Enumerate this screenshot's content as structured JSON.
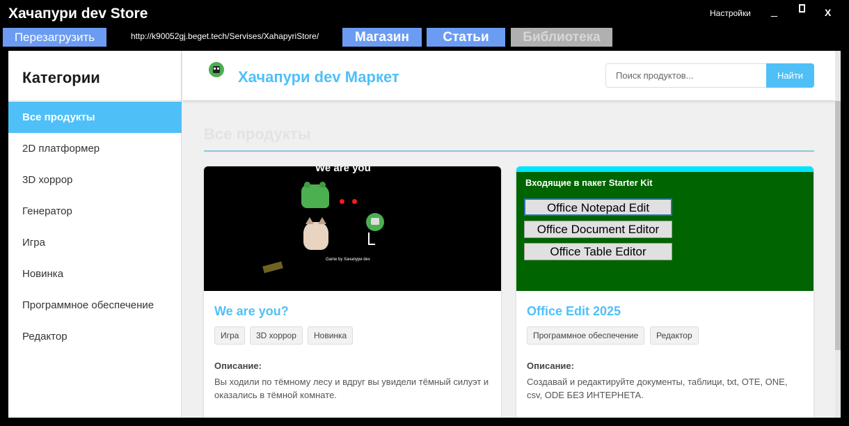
{
  "window": {
    "title": "Хачапури dev Store",
    "settings_label": "Настройки",
    "minimize_label": "_",
    "close_label": "X"
  },
  "toolbar": {
    "reload_label": "Перезагрузить",
    "url": "http://k90052gj.beget.tech/Servises/XahapyriStore/",
    "tabs": [
      {
        "label": "Магазин",
        "active": true
      },
      {
        "label": "Статьи",
        "active": true
      },
      {
        "label": "Библиотека",
        "active": false
      }
    ]
  },
  "sidebar": {
    "title": "Категории",
    "items": [
      {
        "label": "Все продукты",
        "active": true
      },
      {
        "label": "2D платформер"
      },
      {
        "label": "3D хоррор"
      },
      {
        "label": "Генератор"
      },
      {
        "label": "Игра"
      },
      {
        "label": "Новинка"
      },
      {
        "label": "Программное обеспечение"
      },
      {
        "label": "Редактор"
      }
    ]
  },
  "header": {
    "market_title": "Хачапури dev Маркет",
    "search_placeholder": "Поиск продуктов...",
    "search_button": "Найти"
  },
  "main": {
    "section_title": "Все продукты",
    "products": [
      {
        "title": "We are you?",
        "tags": [
          "Игра",
          "3D хоррор",
          "Новинка"
        ],
        "description_label": "Описание:",
        "description": "Вы ходили по тёмному лесу и вдруг вы увидели тёмный силуэт и оказались в тёмной комнате.",
        "image": {
          "caption": "We are you",
          "credit": "Game by Хачапури dev"
        }
      },
      {
        "title": "Office Edit 2025",
        "tags": [
          "Программное обеспечение",
          "Редактор"
        ],
        "description_label": "Описание:",
        "description": "Создавай и редактируйте документы, таблици, txt, OTE, ONE, csv, ODE БЕЗ ИНТЕРНЕТА.",
        "image": {
          "title": "Входящие в пакет Starter Kit",
          "buttons": [
            "Office Notepad Edit",
            "Office Document Editor",
            "Office Table Editor"
          ]
        }
      }
    ]
  },
  "colors": {
    "accent": "#4fc0f7",
    "nav_tab": "#6b9cf2",
    "nav_tab_disabled": "#b0b0b0",
    "office_bg": "#006400"
  }
}
